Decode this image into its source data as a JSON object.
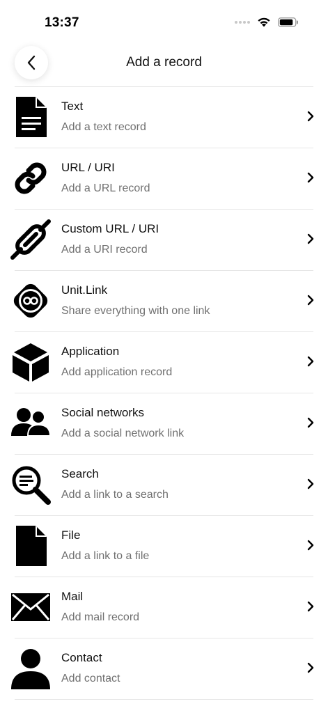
{
  "status": {
    "time": "13:37"
  },
  "nav": {
    "title": "Add a record"
  },
  "records": [
    {
      "title": "Text",
      "subtitle": "Add a text record",
      "icon": "text-document-icon"
    },
    {
      "title": "URL / URI",
      "subtitle": "Add a URL record",
      "icon": "link-icon"
    },
    {
      "title": "Custom URL / URI",
      "subtitle": "Add a URI record",
      "icon": "custom-link-icon"
    },
    {
      "title": "Unit.Link",
      "subtitle": "Share everything with one link",
      "icon": "unit-link-icon"
    },
    {
      "title": "Application",
      "subtitle": "Add application record",
      "icon": "cube-icon"
    },
    {
      "title": "Social networks",
      "subtitle": "Add a social network link",
      "icon": "people-icon"
    },
    {
      "title": "Search",
      "subtitle": "Add a link to a search",
      "icon": "search-icon"
    },
    {
      "title": "File",
      "subtitle": "Add a link to a file",
      "icon": "file-icon"
    },
    {
      "title": "Mail",
      "subtitle": "Add mail record",
      "icon": "mail-icon"
    },
    {
      "title": "Contact",
      "subtitle": "Add contact",
      "icon": "contact-icon"
    }
  ]
}
